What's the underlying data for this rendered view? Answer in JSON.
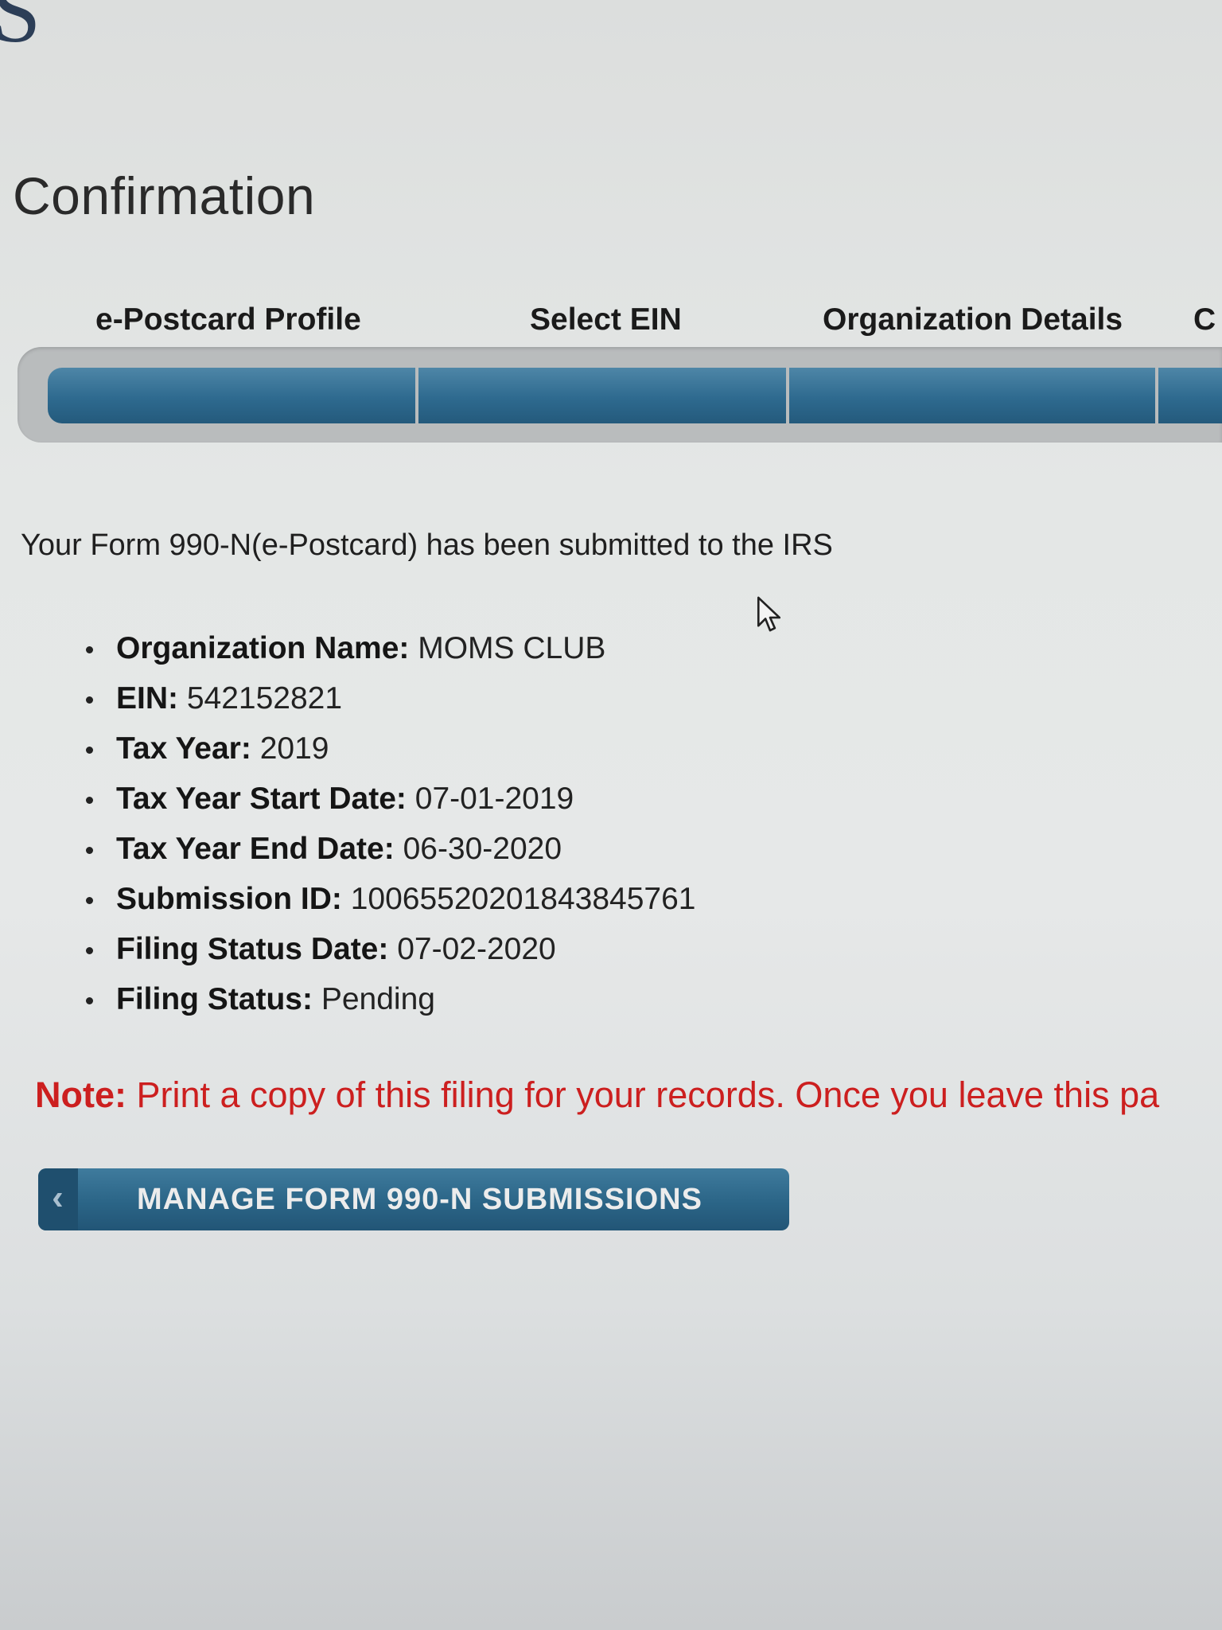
{
  "logo": {
    "fragment": "S"
  },
  "page": {
    "title": "Confirmation"
  },
  "steps": [
    {
      "label": "e-Postcard Profile"
    },
    {
      "label": "Select EIN"
    },
    {
      "label": "Organization Details"
    },
    {
      "label": "C"
    }
  ],
  "confirmation": {
    "message": "Your Form 990-N(e-Postcard) has been submitted to the IRS"
  },
  "details": [
    {
      "label": "Organization Name:",
      "value": "MOMS CLUB"
    },
    {
      "label": "EIN:",
      "value": "542152821"
    },
    {
      "label": "Tax Year:",
      "value": "2019"
    },
    {
      "label": "Tax Year Start Date:",
      "value": "07-01-2019"
    },
    {
      "label": "Tax Year End Date:",
      "value": "06-30-2020"
    },
    {
      "label": "Submission ID:",
      "value": "10065520201843845761"
    },
    {
      "label": "Filing Status Date:",
      "value": "07-02-2020"
    },
    {
      "label": "Filing Status:",
      "value": "Pending"
    }
  ],
  "note": {
    "label": "Note:",
    "text": "Print a copy of this filing for your records. Once you leave this pa"
  },
  "buttons": {
    "manage_label": "MANAGE FORM 990-N SUBMISSIONS",
    "manage_icon": "chevron-left-icon"
  },
  "colors": {
    "accent": "#2e6a8f",
    "note": "#cc1f1f"
  }
}
